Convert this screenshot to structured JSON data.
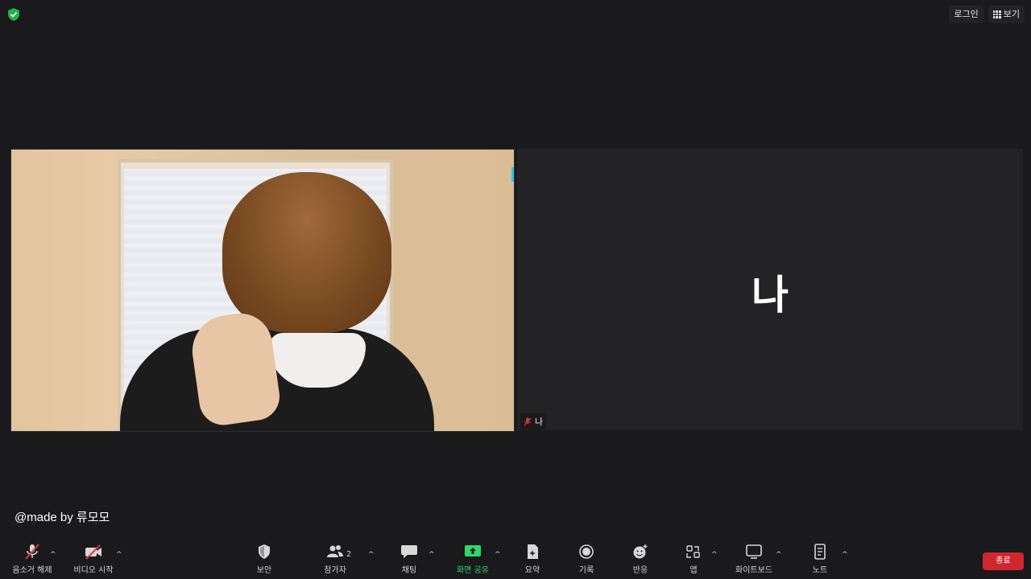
{
  "header": {
    "security_icon": "green-shield-check-icon",
    "login_label": "로그인",
    "view_label": "보기"
  },
  "tiles": {
    "self": {
      "initial": "나",
      "name": "나"
    }
  },
  "overlay": {
    "watermark": "@made by 류모모"
  },
  "toolbar": {
    "mute": "음소거 해제",
    "video": "비디오 시작",
    "security": "보안",
    "participants": "참가자",
    "participants_count": "2",
    "chat": "채팅",
    "share": "화면 공유",
    "summary": "요약",
    "record": "기록",
    "reactions": "반응",
    "apps": "앱",
    "whiteboard": "화이트보드",
    "notes": "노트",
    "end": "종료"
  },
  "colors": {
    "background": "#1a1a1d",
    "share_green": "#2fd86a",
    "end_red": "#d0262d",
    "speaking": "#2ec3e6"
  }
}
